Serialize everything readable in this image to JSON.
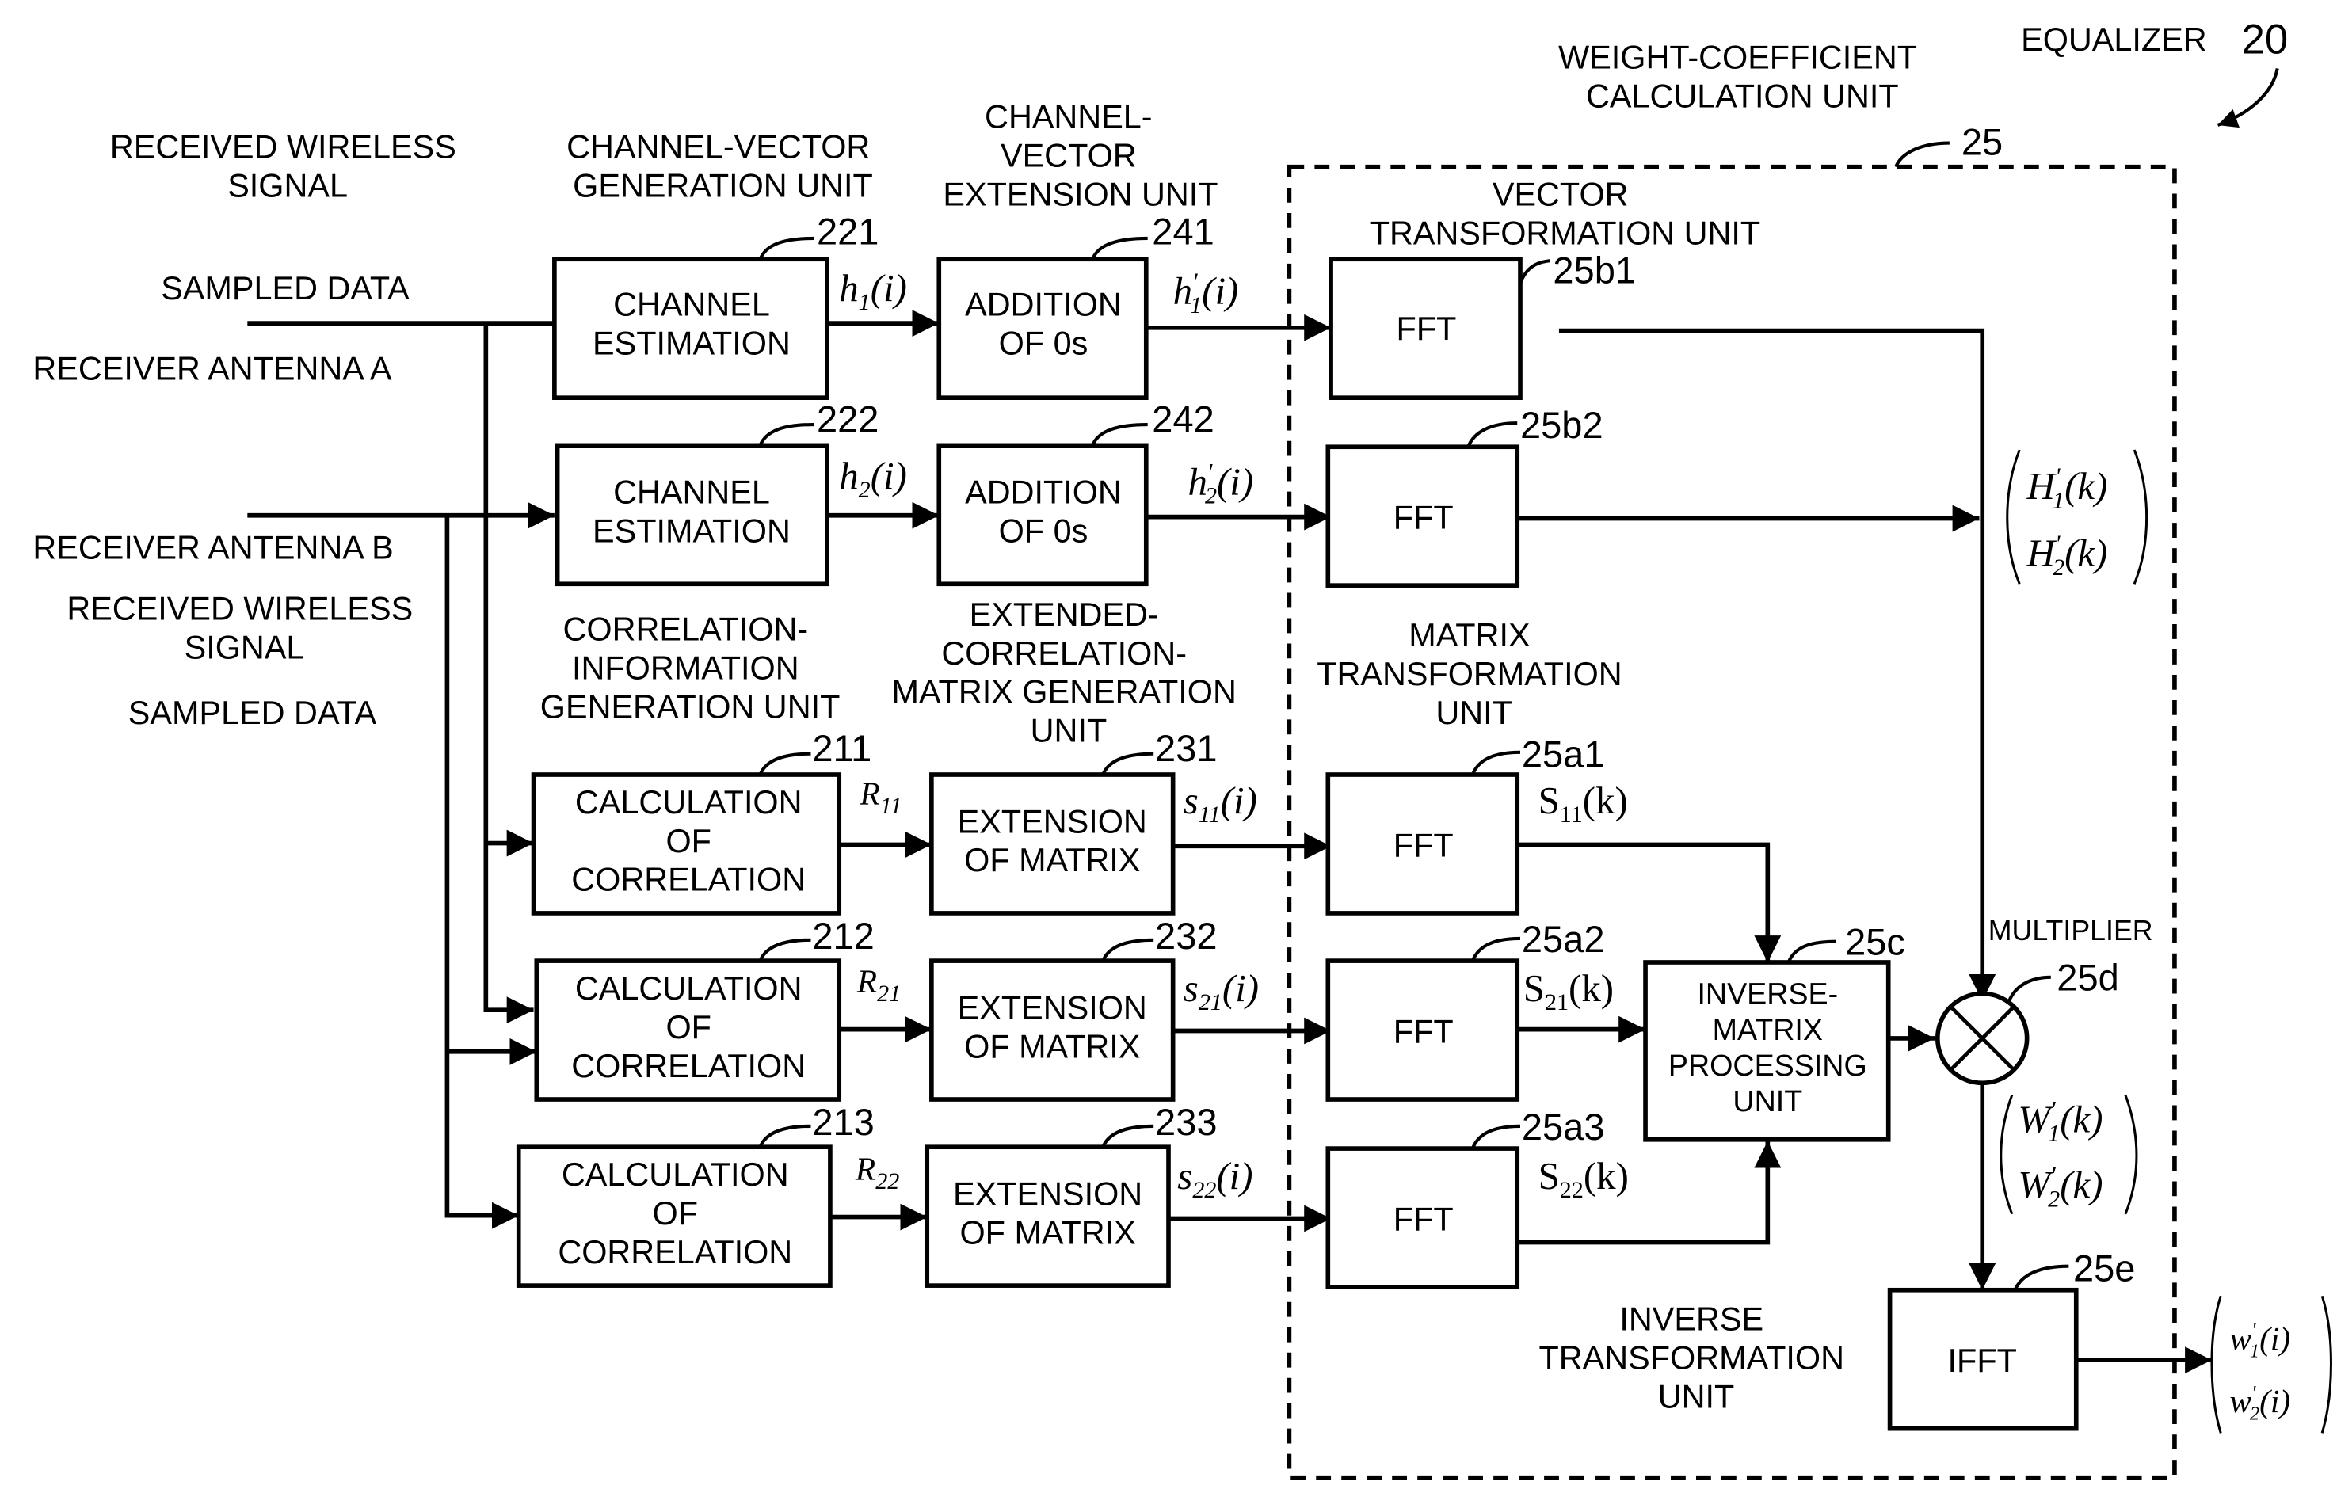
{
  "title": {
    "equalizer_label": "EQUALIZER",
    "equalizer_ref": "20"
  },
  "section_labels": {
    "received_signal_a": [
      "RECEIVED WIRELESS",
      "SIGNAL"
    ],
    "sampled_data_a": "SAMPLED DATA",
    "antenna_a": "RECEIVER ANTENNA A",
    "antenna_b": "RECEIVER ANTENNA B",
    "received_signal_b": [
      "RECEIVED WIRELESS",
      "SIGNAL"
    ],
    "sampled_data_b": "SAMPLED DATA",
    "channel_vector_generation": [
      "CHANNEL-VECTOR",
      "GENERATION UNIT"
    ],
    "channel_vector_extension": [
      "CHANNEL-",
      "VECTOR",
      "EXTENSION UNIT"
    ],
    "correlation_info_generation": [
      "CORRELATION-",
      "INFORMATION",
      "GENERATION UNIT"
    ],
    "extended_correlation_matrix": [
      "EXTENDED-",
      "CORRELATION-",
      "MATRIX GENERATION",
      "UNIT"
    ],
    "weight_coefficient_calc": [
      "WEIGHT-COEFFICIENT",
      "CALCULATION UNIT"
    ],
    "weight_coefficient_ref": "25",
    "vector_transformation": [
      "VECTOR",
      "TRANSFORMATION UNIT"
    ],
    "matrix_transformation": [
      "MATRIX",
      "TRANSFORMATION",
      "UNIT"
    ],
    "inverse_transformation": [
      "INVERSE",
      "TRANSFORMATION",
      "UNIT"
    ],
    "multiplier": "MULTIPLIER"
  },
  "blocks": {
    "ch_est_1": {
      "lines": [
        "CHANNEL",
        "ESTIMATION"
      ],
      "ref": "221"
    },
    "ch_est_2": {
      "lines": [
        "CHANNEL",
        "ESTIMATION"
      ],
      "ref": "222"
    },
    "add_zeros_1": {
      "lines": [
        "ADDITION",
        "OF 0s"
      ],
      "ref": "241"
    },
    "add_zeros_2": {
      "lines": [
        "ADDITION",
        "OF 0s"
      ],
      "ref": "242"
    },
    "calc_corr_1": {
      "lines": [
        "CALCULATION",
        "OF",
        "CORRELATION"
      ],
      "ref": "211"
    },
    "calc_corr_2": {
      "lines": [
        "CALCULATION",
        "OF",
        "CORRELATION"
      ],
      "ref": "212"
    },
    "calc_corr_3": {
      "lines": [
        "CALCULATION",
        "OF",
        "CORRELATION"
      ],
      "ref": "213"
    },
    "ext_matrix_1": {
      "lines": [
        "EXTENSION",
        "OF MATRIX"
      ],
      "ref": "231"
    },
    "ext_matrix_2": {
      "lines": [
        "EXTENSION",
        "OF MATRIX"
      ],
      "ref": "232"
    },
    "ext_matrix_3": {
      "lines": [
        "EXTENSION",
        "OF MATRIX"
      ],
      "ref": "233"
    },
    "fft_b1": {
      "lines": [
        "FFT"
      ],
      "ref": "25b1"
    },
    "fft_b2": {
      "lines": [
        "FFT"
      ],
      "ref": "25b2"
    },
    "fft_a1": {
      "lines": [
        "FFT"
      ],
      "ref": "25a1"
    },
    "fft_a2": {
      "lines": [
        "FFT"
      ],
      "ref": "25a2"
    },
    "fft_a3": {
      "lines": [
        "FFT"
      ],
      "ref": "25a3"
    },
    "inverse_matrix": {
      "lines": [
        "INVERSE-",
        "MATRIX",
        "PROCESSING",
        "UNIT"
      ],
      "ref": "25c"
    },
    "multiplier": {
      "ref": "25d"
    },
    "ifft": {
      "lines": [
        "IFFT"
      ],
      "ref": "25e"
    }
  },
  "signals": {
    "h1": {
      "base": "h",
      "sub": "1",
      "arg": "(i)"
    },
    "h2": {
      "base": "h",
      "sub": "2",
      "arg": "(i)"
    },
    "h1p": {
      "base": "h",
      "prime": "'",
      "sub": "1",
      "arg": "(i)"
    },
    "h2p": {
      "base": "h",
      "prime": "'",
      "sub": "2",
      "arg": "(i)"
    },
    "R11": {
      "base": "R",
      "sub": "11"
    },
    "R21": {
      "base": "R",
      "sub": "21"
    },
    "R22": {
      "base": "R",
      "sub": "22"
    },
    "s11": {
      "base": "s",
      "sub": "11",
      "arg": "(i)"
    },
    "s21": {
      "base": "s",
      "sub": "21",
      "arg": "(i)"
    },
    "s22": {
      "base": "s",
      "sub": "22",
      "arg": "(i)"
    },
    "S11": {
      "base": "S",
      "sub": "11",
      "arg": "(k)"
    },
    "S21": {
      "base": "S",
      "sub": "21",
      "arg": "(k)"
    },
    "S22": {
      "base": "S",
      "sub": "22",
      "arg": "(k)"
    },
    "H_vec": [
      {
        "base": "H",
        "prime": "'",
        "sub": "1",
        "arg": "(k)"
      },
      {
        "base": "H",
        "prime": "'",
        "sub": "2",
        "arg": "(k)"
      }
    ],
    "W_vec": [
      {
        "base": "W",
        "prime": "'",
        "sub": "1",
        "arg": "(k)"
      },
      {
        "base": "W",
        "prime": "'",
        "sub": "2",
        "arg": "(k)"
      }
    ],
    "w_vec": [
      {
        "base": "w",
        "prime": "'",
        "sub": "1",
        "arg": "(i)"
      },
      {
        "base": "w",
        "prime": "'",
        "sub": "2",
        "arg": "(i)"
      }
    ]
  }
}
